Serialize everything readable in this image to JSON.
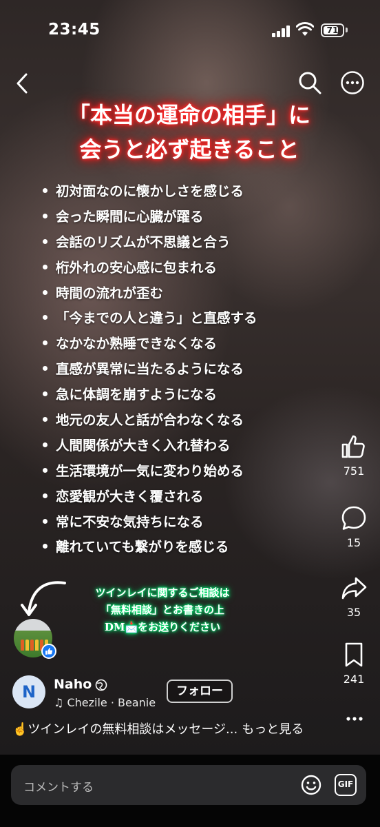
{
  "status_bar": {
    "time": "23:45",
    "battery": "71"
  },
  "post": {
    "headline_line1": "「本当の運命の相手」に",
    "headline_line2": "会うと必ず起きること",
    "items": [
      "初対面なのに懐かしさを感じる",
      "会った瞬間に心臓が躍る",
      "会話のリズムが不思議と合う",
      "桁外れの安心感に包まれる",
      "時間の流れが歪む",
      "「今までの人と違う」と直感する",
      "なかなか熟睡できなくなる",
      "直感が異常に当たるようになる",
      "急に体調を崩すようになる",
      "地元の友人と話が合わなくなる",
      "人間関係が大きく入れ替わる",
      "生活環境が一気に変わり始める",
      "恋愛観が大きく覆される",
      "常に不安な気持ちになる",
      "離れていても繋がりを感じる"
    ],
    "consult_line1": "ツインレイに関するご相談は",
    "consult_line2": "「無料相談」とお書きの上",
    "consult_line3": "DM📩をお送りください"
  },
  "actions": {
    "likes": "751",
    "comments": "15",
    "shares": "35",
    "saves": "241"
  },
  "author": {
    "avatar_letter": "N",
    "name": "Naho",
    "audio": "Chezile · Beanie",
    "follow_label": "フォロー"
  },
  "caption": {
    "text": "☝️ツインレイの無料相談はメッセージ...",
    "more_label": "もっと見る"
  },
  "comment": {
    "placeholder": "コメントする",
    "gif_label": "GIF"
  }
}
